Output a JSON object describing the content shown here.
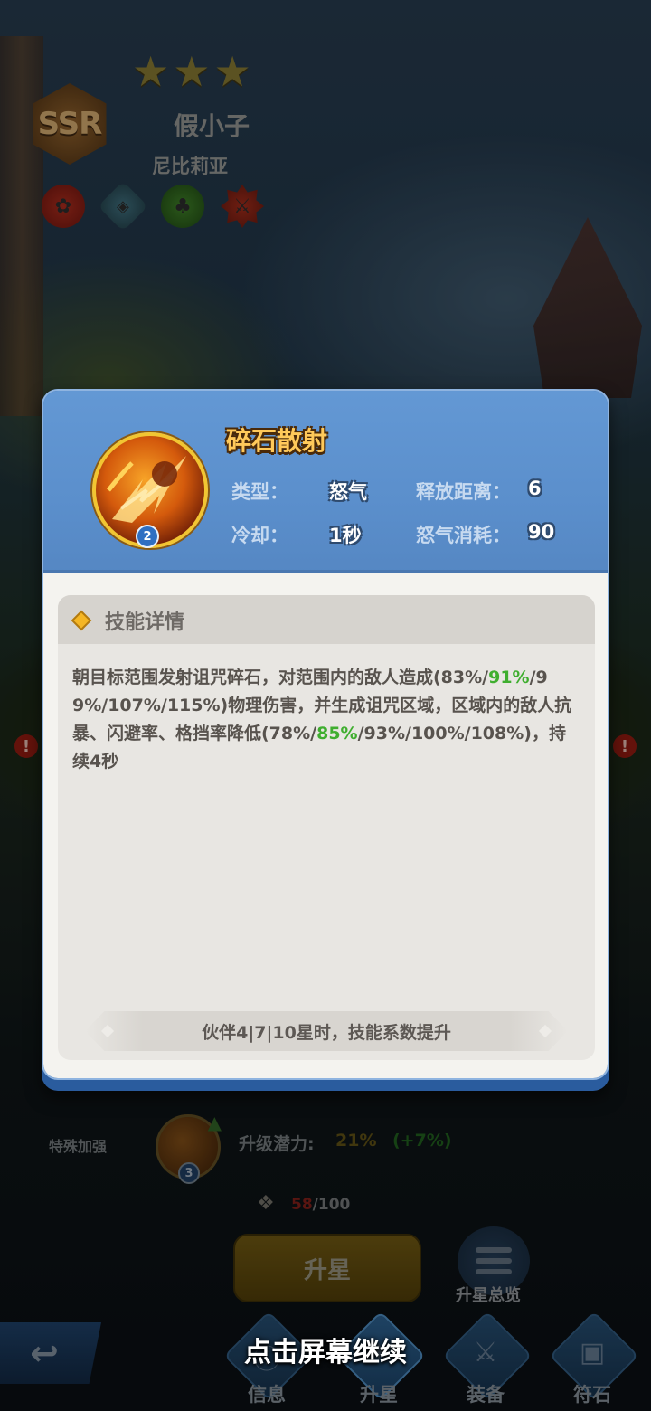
{
  "hero": {
    "rarity": "SSR",
    "stars": 3,
    "name": "假小子",
    "subtitle": "尼比莉亚",
    "trait_icons": [
      "paw-icon",
      "shield-icon",
      "tree-icon",
      "sword-icon"
    ]
  },
  "alerts": [
    "!",
    "!"
  ],
  "skill_popup": {
    "name": "碎石散射",
    "level": "2",
    "stats": [
      {
        "label": "类型：",
        "value": "怒气"
      },
      {
        "label": "释放距离：",
        "value": "6"
      },
      {
        "label": "冷却：",
        "value": "1秒"
      },
      {
        "label": "怒气消耗：",
        "value": "90"
      }
    ],
    "detail_title": "技能详情",
    "description": {
      "p1": "朝目标范围发射诅咒碎石，对范围内的敌人造成(83%/",
      "h1": "91%",
      "p2": "/99%/107%/115%)物理伤害，并生成诅咒区域，区域内的敌人抗暴、闪避率、格挡率降低(78%/",
      "h2": "85%",
      "p3": "/93%/100%/108%)，持续4秒"
    },
    "footer": "伙伴4|7|10星时，技能系数提升",
    "colors": {
      "header": "#5b8fcc",
      "highlight": "#3fae2f",
      "title": "#ffc95a"
    }
  },
  "upgrade": {
    "special_label": "特殊加强",
    "small_skill_level": "3",
    "potential_label": "升级潜力:",
    "potential_value": "21%",
    "potential_bonus": "(+7%)",
    "shard_current": "58",
    "shard_total": "/100",
    "upstar_button": "升星",
    "overview_label": "升星总览"
  },
  "continue_text": "点击屏幕继续",
  "nav": {
    "back_icon": "back-arrow-icon",
    "items": [
      {
        "label": "信息",
        "icon": "info-icon"
      },
      {
        "label": "升星",
        "icon": "star-up-icon"
      },
      {
        "label": "装备",
        "icon": "sword-icon"
      },
      {
        "label": "符石",
        "icon": "rune-card-icon"
      }
    ]
  }
}
